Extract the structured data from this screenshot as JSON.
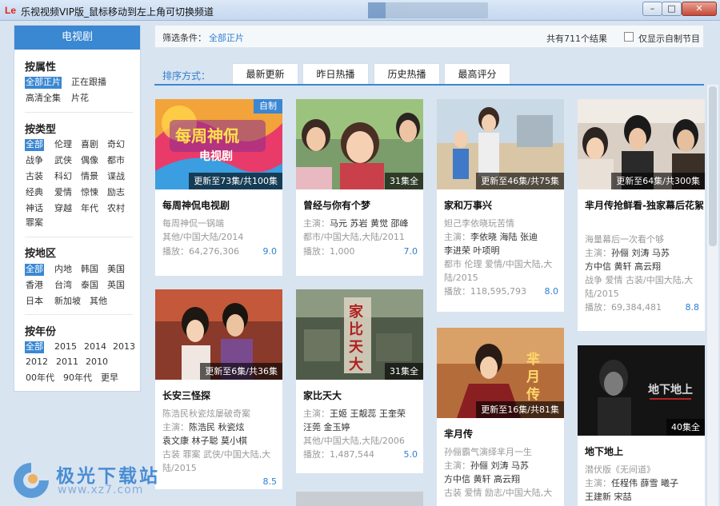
{
  "window": {
    "logo": "Le",
    "title": "乐视视频VIP版_鼠标移动到左上角可切换频道",
    "min_label": "–",
    "max_label": "□",
    "close_label": "✕"
  },
  "sidebar": {
    "header": "电视剧",
    "attr_title": "按属性",
    "attr": [
      "全部正片",
      "正在跟播",
      "高清全集",
      "片花"
    ],
    "type_title": "按类型",
    "types": [
      "全部",
      "伦理",
      "喜剧",
      "奇幻",
      "战争",
      "武侠",
      "偶像",
      "都市",
      "古装",
      "科幻",
      "情景",
      "谍战",
      "经典",
      "爱情",
      "惊悚",
      "励志",
      "神话",
      "穿越",
      "年代",
      "农村",
      "罪案"
    ],
    "region_title": "按地区",
    "regions": [
      "全部",
      "内地",
      "韩国",
      "美国",
      "香港",
      "台湾",
      "泰国",
      "英国",
      "日本",
      "新加坡",
      "其他"
    ],
    "year_title": "按年份",
    "years": [
      "全部",
      "2015",
      "2014",
      "2013",
      "2012",
      "2011",
      "2010",
      "00年代",
      "90年代",
      "更早"
    ]
  },
  "filter": {
    "label": "筛选条件：",
    "value": "全部正片",
    "total": "共有711个结果",
    "only_self_label": "仅显示自制节目"
  },
  "sort": {
    "label": "排序方式：",
    "tabs": [
      "最新更新",
      "昨日热播",
      "历史热播",
      "最高评分"
    ]
  },
  "cards": [
    {
      "title": "每周神侃电视剧",
      "badge": "更新至73集/共100集",
      "corner": "自制",
      "lines": [
        {
          "t": "plain",
          "v": "每周神侃一锅端"
        },
        {
          "t": "plain",
          "v": "其他/中国大陆/2014"
        }
      ],
      "plays_label": "播放：",
      "plays": "64,276,306",
      "rating": "9.0"
    },
    {
      "title": "曾经与你有个梦",
      "badge": "31集全",
      "lines": [
        {
          "t": "kv",
          "k": "主演：",
          "v": "马元 苏岩 黄觉 邵峰"
        },
        {
          "t": "plain",
          "v": "都市/中国大陆,大陆/2011"
        }
      ],
      "plays_label": "播放：",
      "plays": "1,000",
      "rating": "7.0"
    },
    {
      "title": "家和万事兴",
      "badge": "更新至46集/共75集",
      "lines": [
        {
          "t": "plain",
          "v": "妲己李依晓玩苦情"
        },
        {
          "t": "kv",
          "k": "主演：",
          "v": "李依晓 海陆 张迪"
        },
        {
          "t": "v",
          "v": "李进荣 叶项明"
        },
        {
          "t": "plain",
          "v": "都市 伦理 爱情/中国大陆,大"
        },
        {
          "t": "plain",
          "v": "陆/2015"
        }
      ],
      "plays_label": "播放：",
      "plays": "118,595,793",
      "rating": "8.0"
    },
    {
      "title": "芈月传抢鲜看-独家幕后花絮",
      "badge": "更新至64集/共300集",
      "lines": [
        {
          "t": "plain",
          "v": "海量幕后一次看个够"
        },
        {
          "t": "kv",
          "k": "主演：",
          "v": "孙俪 刘涛 马苏"
        },
        {
          "t": "v",
          "v": "方中信 黄轩 高云翔"
        },
        {
          "t": "plain",
          "v": "战争 爱情 古装/中国大陆,大"
        },
        {
          "t": "plain",
          "v": "陆/2015"
        }
      ],
      "plays_label": "播放：",
      "plays": "69,384,481",
      "rating": "8.8"
    },
    {
      "title": "长安三怪探",
      "badge": "更新至6集/共36集",
      "lines": [
        {
          "t": "plain",
          "v": "陈浩民秋瓷炫屡破奇案"
        },
        {
          "t": "kv",
          "k": "主演：",
          "v": "陈浩民 秋瓷炫"
        },
        {
          "t": "v",
          "v": "袁文康 林子聪 莫小棋"
        },
        {
          "t": "plain",
          "v": "古装 罪案 武侠/中国大陆,大"
        },
        {
          "t": "plain",
          "v": "陆/2015"
        }
      ],
      "rating": "8.5"
    },
    {
      "title": "家比天大",
      "badge": "31集全",
      "lines": [
        {
          "t": "kv",
          "k": "主演：",
          "v": "王姬 王靓蕊 王奎荣"
        },
        {
          "t": "v",
          "v": "汪莞 金玉婷"
        },
        {
          "t": "plain",
          "v": "其他/中国大陆,大陆/2006"
        }
      ],
      "plays_label": "播放：",
      "plays": "1,487,544",
      "rating": "5.0"
    },
    {
      "title": "芈月传",
      "badge": "更新至16集/共81集",
      "lines": [
        {
          "t": "plain",
          "v": "孙俪霸气演绎芈月一生"
        },
        {
          "t": "kv",
          "k": "主演：",
          "v": "孙俪 刘涛 马苏"
        },
        {
          "t": "v",
          "v": "方中信 黄轩 高云翔"
        },
        {
          "t": "plain",
          "v": "古装 爱情 励志/中国大陆,大"
        }
      ]
    },
    {
      "title": "地下地上",
      "badge": "40集全",
      "lines": [
        {
          "t": "plain",
          "v": "潜伏版《无间道》"
        },
        {
          "t": "kv",
          "k": "主演：",
          "v": "任程伟 薛雪 曦子"
        },
        {
          "t": "v",
          "v": "王建新 宋喆"
        }
      ]
    }
  ],
  "watermark": {
    "name": "极光下载站",
    "url": "www.xz7.com"
  },
  "colors": {
    "accent": "#3a87d2",
    "rating": "#2f7fd0"
  }
}
